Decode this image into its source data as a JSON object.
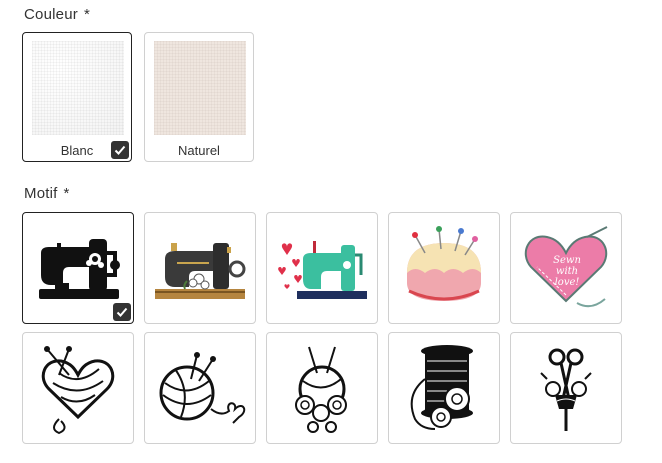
{
  "couleur": {
    "label": "Couleur",
    "required_mark": "*",
    "options": [
      {
        "name": "Blanc",
        "selected": true,
        "color": "#f7f7f7"
      },
      {
        "name": "Naturel",
        "selected": false,
        "color": "#efe6df"
      }
    ]
  },
  "motif": {
    "label": "Motif",
    "required_mark": "*",
    "options": [
      {
        "id": "sewing-machine-black",
        "selected": true
      },
      {
        "id": "vintage-sewing-machine",
        "selected": false
      },
      {
        "id": "sewing-machine-hearts",
        "selected": false
      },
      {
        "id": "pincushion",
        "selected": false
      },
      {
        "id": "sewn-with-love-heart",
        "selected": false,
        "text": "Sewn with love!"
      },
      {
        "id": "yarn-heart",
        "selected": false
      },
      {
        "id": "yarn-ball",
        "selected": false
      },
      {
        "id": "yarn-flowers",
        "selected": false
      },
      {
        "id": "thread-spool-roses",
        "selected": false
      },
      {
        "id": "scissors-bouquet",
        "selected": false
      }
    ]
  },
  "colors": {
    "text": "#333333",
    "border": "#d0d0d0",
    "selected_border": "#222222",
    "check_bg": "#333333"
  }
}
